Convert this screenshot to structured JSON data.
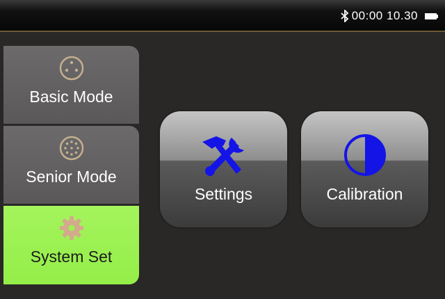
{
  "status": {
    "time": "00:00 10.30",
    "bluetooth_icon": "bluetooth-icon",
    "battery_icon": "battery-icon"
  },
  "sidebar": {
    "items": [
      {
        "label": "Basic Mode",
        "icon": "dial-3-dot-icon",
        "active": false
      },
      {
        "label": "Senior Mode",
        "icon": "dial-ring-dots-icon",
        "active": false
      },
      {
        "label": "System Set",
        "icon": "gear-icon",
        "active": true
      }
    ]
  },
  "tiles": [
    {
      "label": "Settings",
      "icon": "tools-icon"
    },
    {
      "label": "Calibration",
      "icon": "half-circle-icon"
    }
  ],
  "colors": {
    "accent_active": "#9cf051",
    "icon_blue": "#1414e6",
    "divider": "#6b5a34"
  }
}
